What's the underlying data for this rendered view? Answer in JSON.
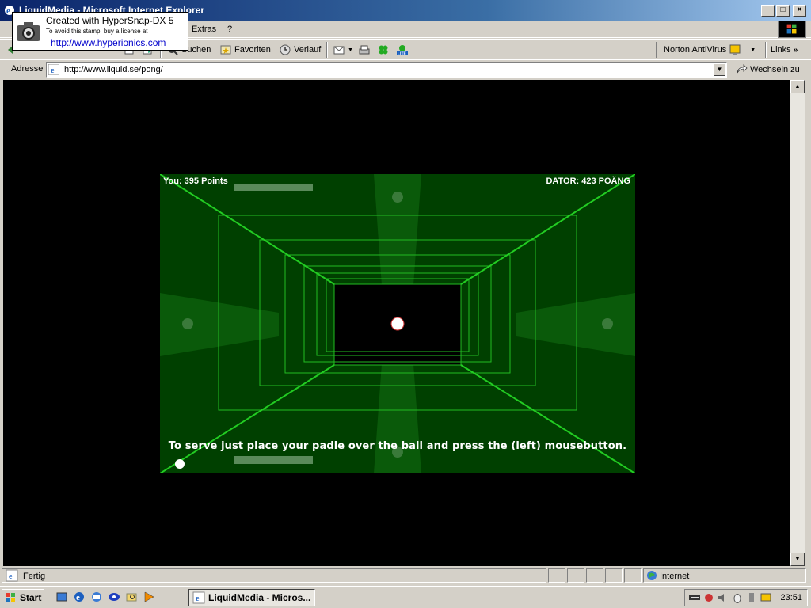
{
  "window": {
    "title": "LiquidMedia - Microsoft Internet Explorer"
  },
  "stamp": {
    "line1": "Created with HyperSnap-DX 5",
    "line2": "To avoid this stamp, buy a license at",
    "line3": "http://www.hyperionics.com"
  },
  "menu": {
    "items": [
      "Extras",
      "?"
    ]
  },
  "toolbar": {
    "search_label": "Suchen",
    "favorites_label": "Favoriten",
    "history_label": "Verlauf",
    "norton_label": "Norton AntiVirus",
    "links_label": "Links"
  },
  "address": {
    "label": "Adresse",
    "url": "http://www.liquid.se/pong/",
    "go_label": "Wechseln zu"
  },
  "game": {
    "player_score": "You: 395 Points",
    "computer_score": "DATOR: 423 POÄNG",
    "serve_message": "To serve just place your padle over the ball and press the (left) mousebutton."
  },
  "status": {
    "text": "Fertig",
    "zone": "Internet"
  },
  "taskbar": {
    "start_label": "Start",
    "task_label": "LiquidMedia - Micros...",
    "clock": "23:51"
  },
  "colors": {
    "game_background": "#004000",
    "neon_line": "#22cc22",
    "title_gradient_start": "#0a246a"
  }
}
